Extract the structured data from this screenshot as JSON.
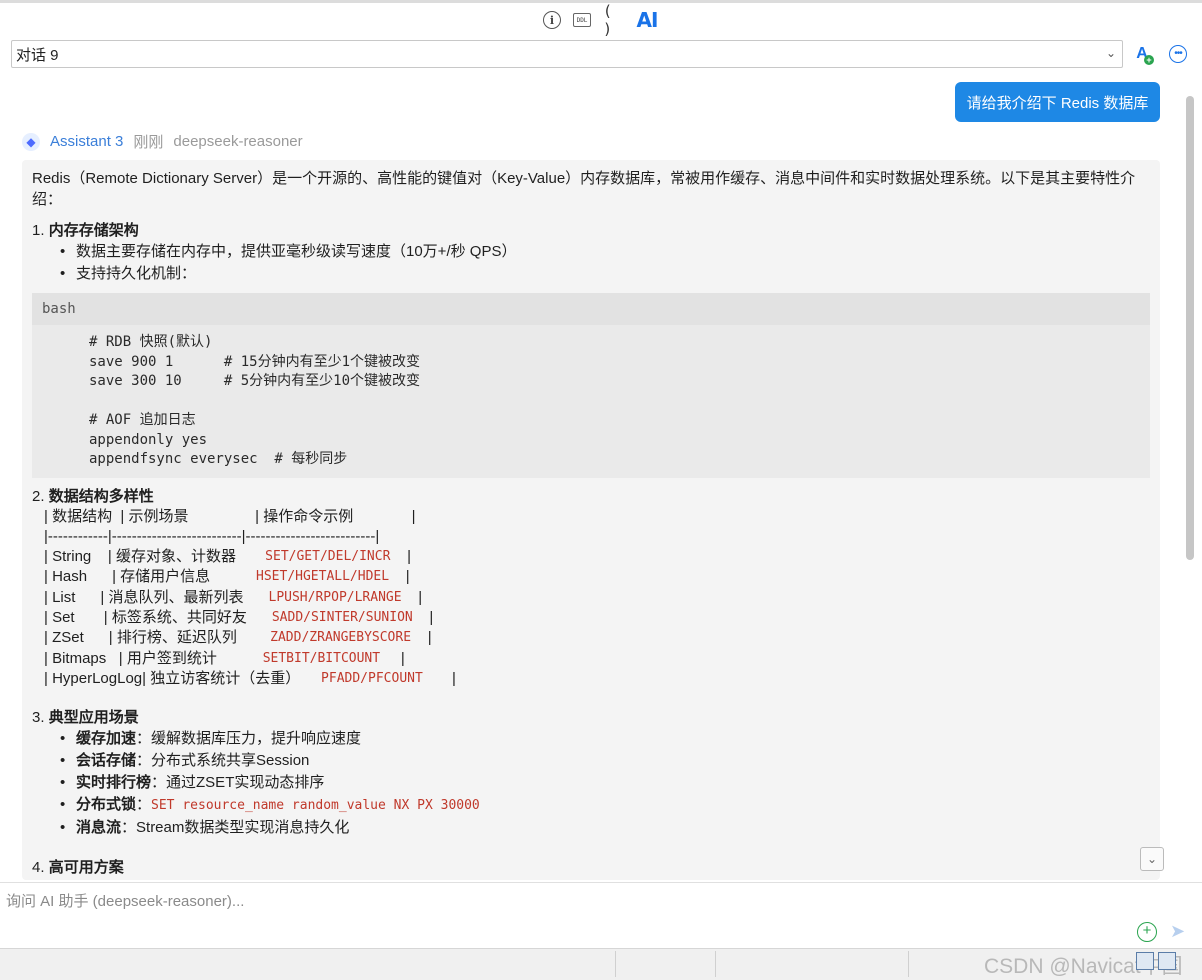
{
  "toolbar": {
    "info_icon": "info-icon",
    "ddl_label": "DDL",
    "paren_label": "( )",
    "ai_label": "AI"
  },
  "conversation": {
    "selected": "对话 9"
  },
  "user_message": "请给我介绍下 Redis 数据库",
  "assistant": {
    "name": "Assistant 3",
    "time": "刚刚",
    "model": "deepseek-reasoner"
  },
  "content": {
    "intro": "Redis（Remote Dictionary Server）是一个开源的、高性能的键值对（Key-Value）内存数据库，常被用作缓存、消息中间件和实时数据处理系统。以下是其主要特性介绍：",
    "sec1": {
      "num": "1. ",
      "title": "内存存储架构"
    },
    "sec1_items": [
      "数据主要存储在内存中，提供亚毫秒级读写速度（10万+/秒 QPS）",
      "支持持久化机制："
    ],
    "code_lang": "bash",
    "code_lines": [
      "# RDB 快照(默认)",
      "save 900 1      # 15分钟内有至少1个键被改变",
      "save 300 10     # 5分钟内有至少10个键被改变",
      "",
      "# AOF 追加日志",
      "appendonly yes",
      "appendfsync everysec  # 每秒同步"
    ],
    "sec2": {
      "num": "2. ",
      "title": "数据结构多样性"
    },
    "table_header": [
      "| 数据结构  ",
      "| 示例场景                ",
      "| 操作命令示例              ",
      "|"
    ],
    "table_sep": "|------------|--------------------------|--------------------------|",
    "table_rows": [
      {
        "a": "| String    ",
        "b": "| 缓存对象、计数器       ",
        "c": "SET/GET/DEL/INCR",
        "d": "    |"
      },
      {
        "a": "| Hash      ",
        "b": "| 存储用户信息           ",
        "c": "HSET/HGETALL/HDEL",
        "d": "    |"
      },
      {
        "a": "| List      ",
        "b": "| 消息队列、最新列表      ",
        "c": "LPUSH/RPOP/LRANGE",
        "d": "    |"
      },
      {
        "a": "| Set       ",
        "b": "| 标签系统、共同好友      ",
        "c": "SADD/SINTER/SUNION",
        "d": "    |"
      },
      {
        "a": "| ZSet      ",
        "b": "| 排行榜、延迟队列        ",
        "c": "ZADD/ZRANGEBYSCORE",
        "d": "    |"
      },
      {
        "a": "| Bitmaps   ",
        "b": "| 用户签到统计           ",
        "c": "SETBIT/BITCOUNT",
        "d": "     |"
      },
      {
        "a": "| HyperLogLog",
        "b": "| 独立访客统计（去重）     ",
        "c": "PFADD/PFCOUNT",
        "d": "       |"
      }
    ],
    "sec3": {
      "num": "3. ",
      "title": "典型应用场景"
    },
    "sec3_items": [
      {
        "k": "缓存加速",
        "v": "：缓解数据库压力，提升响应速度"
      },
      {
        "k": "会话存储",
        "v": "：分布式系统共享Session"
      },
      {
        "k": "实时排行榜",
        "v": "：通过ZSET实现动态排序"
      },
      {
        "k": "分布式锁",
        "v": "：",
        "code": "SET resource_name random_value NX PX 30000"
      },
      {
        "k": "消息流",
        "v": "：Stream数据类型实现消息持久化"
      }
    ],
    "sec4": {
      "num": "4. ",
      "title": "高可用方案"
    }
  },
  "input": {
    "placeholder": "询问 AI 助手 (deepseek-reasoner)..."
  },
  "watermark": "CSDN @Navicat中国",
  "colors": {
    "accent": "#1a73e8",
    "user_bubble": "#1e88e5",
    "assistant_name": "#3b7fd9",
    "code_red": "#c0392b",
    "attach_green": "#2aa44f"
  }
}
